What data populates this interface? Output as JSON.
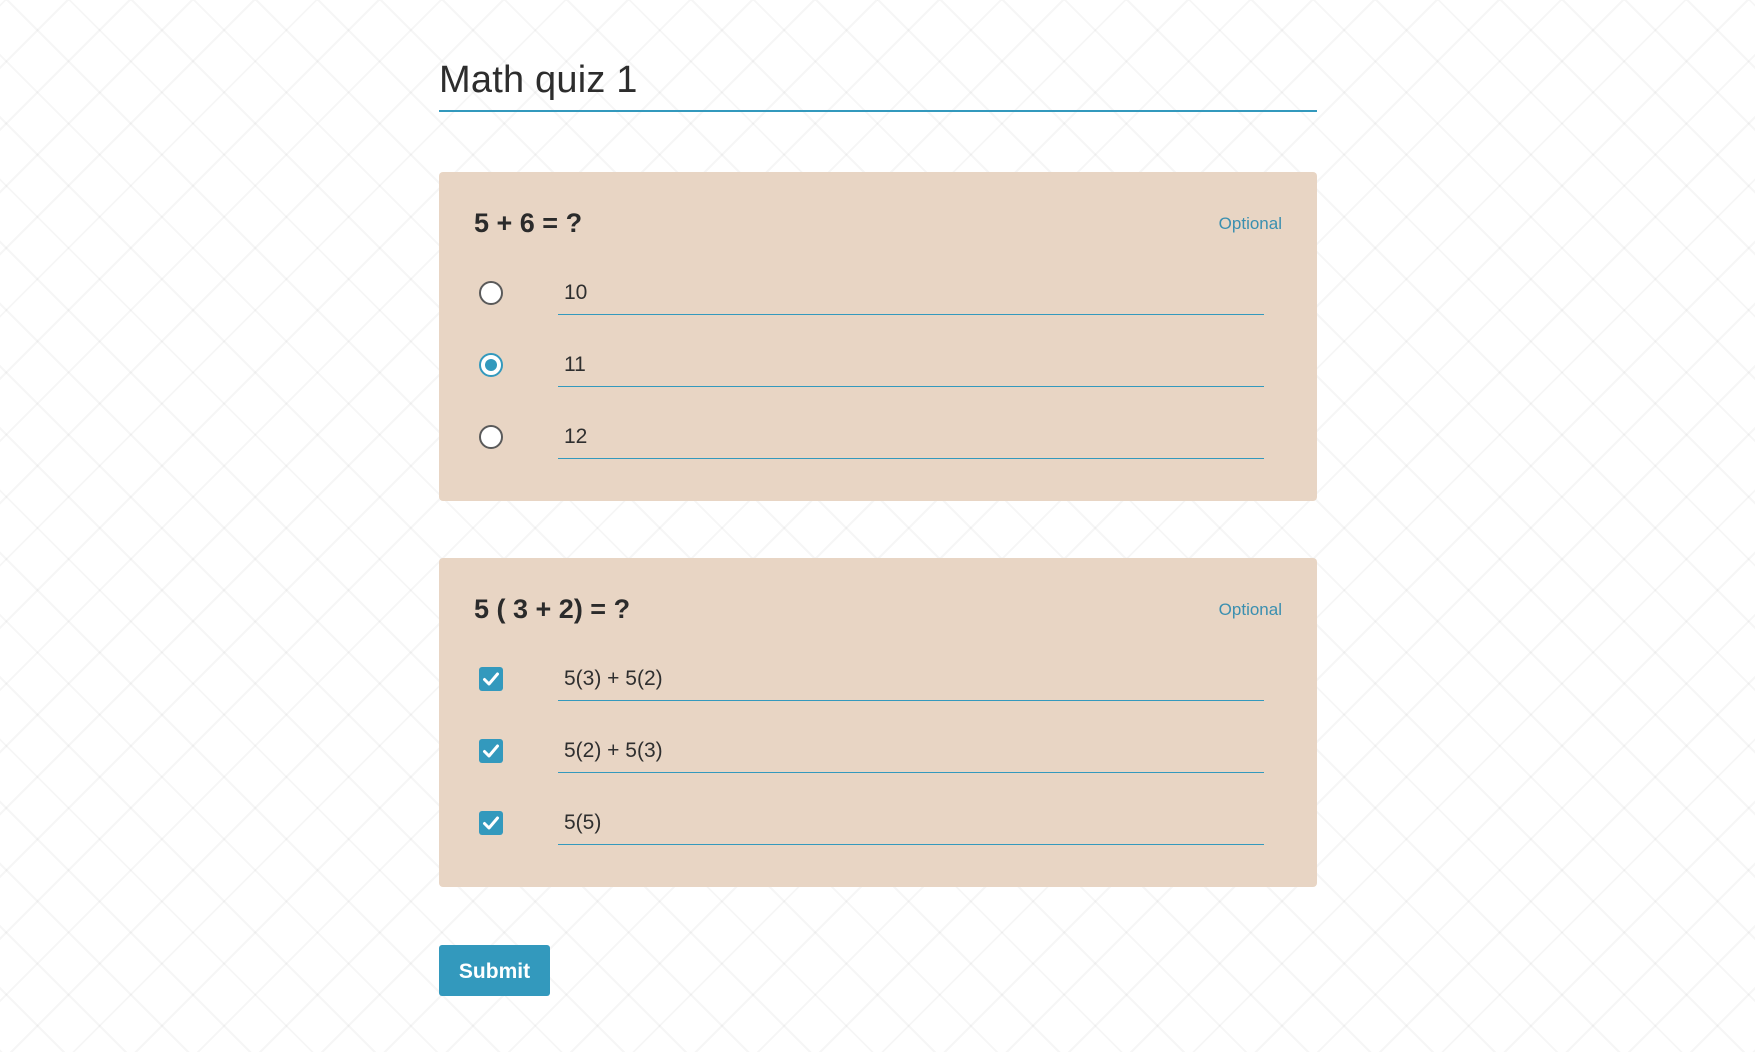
{
  "form": {
    "title": "Math quiz 1"
  },
  "questions": [
    {
      "text": "5 + 6 = ?",
      "optional_label": "Optional",
      "type": "radio",
      "options": [
        {
          "label": "10",
          "selected": false
        },
        {
          "label": "11",
          "selected": true
        },
        {
          "label": "12",
          "selected": false
        }
      ]
    },
    {
      "text": "5 ( 3 + 2) = ?",
      "optional_label": "Optional",
      "type": "checkbox",
      "options": [
        {
          "label": "5(3) + 5(2)",
          "selected": true
        },
        {
          "label": "5(2) + 5(3)",
          "selected": true
        },
        {
          "label": "5(5)",
          "selected": true
        }
      ]
    }
  ],
  "submit": {
    "label": "Submit"
  },
  "colors": {
    "accent": "#3399bd",
    "card_background": "#e8d5c4",
    "text": "#2b2b2b"
  },
  "icons": {
    "radio_unchecked": "radio-unchecked-icon",
    "radio_checked": "radio-checked-icon",
    "checkbox_checked": "checkbox-checked-icon"
  }
}
